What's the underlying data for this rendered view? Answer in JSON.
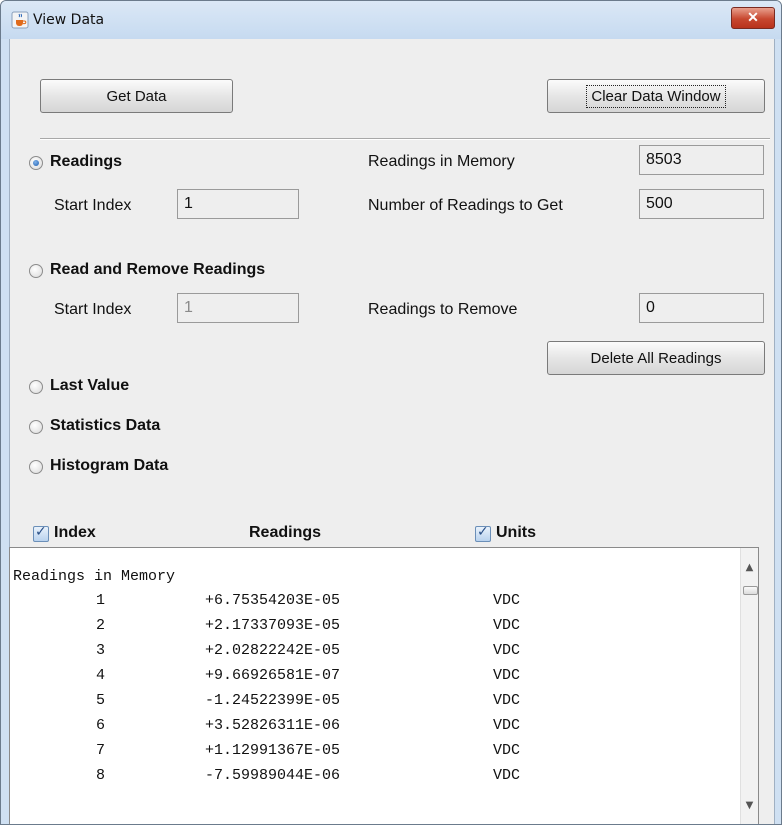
{
  "window": {
    "title": "View Data",
    "close_label": "✕",
    "icon": "java-cup-icon"
  },
  "toolbar": {
    "get_data_label": "Get Data",
    "clear_label": "Clear Data Window"
  },
  "readings": {
    "label": "Readings",
    "selected": true,
    "start_index_label": "Start Index",
    "start_index_value": "1",
    "in_memory_label": "Readings in Memory",
    "in_memory_value": "8503",
    "count_label": "Number of Readings to Get",
    "count_value": "500"
  },
  "read_remove": {
    "label": "Read and Remove Readings",
    "start_index_label": "Start Index",
    "start_index_value": "1",
    "remove_label": "Readings to Remove",
    "remove_value": "0",
    "delete_all_label": "Delete All Readings"
  },
  "options": {
    "last_value": "Last Value",
    "statistics": "Statistics Data",
    "histogram": "Histogram Data"
  },
  "columns": {
    "index": "Index",
    "readings": "Readings",
    "units": "Units",
    "index_checked": true,
    "units_checked": true
  },
  "output": {
    "title": "Readings in Memory",
    "rows": [
      {
        "index": "1",
        "value": "+6.75354203E-05",
        "unit": "VDC"
      },
      {
        "index": "2",
        "value": "+2.17337093E-05",
        "unit": "VDC"
      },
      {
        "index": "3",
        "value": "+2.02822242E-05",
        "unit": "VDC"
      },
      {
        "index": "4",
        "value": "+9.66926581E-07",
        "unit": "VDC"
      },
      {
        "index": "5",
        "value": "-1.24522399E-05",
        "unit": "VDC"
      },
      {
        "index": "6",
        "value": "+3.52826311E-06",
        "unit": "VDC"
      },
      {
        "index": "7",
        "value": "+1.12991367E-05",
        "unit": "VDC"
      },
      {
        "index": "8",
        "value": "-7.59989044E-06",
        "unit": "VDC"
      }
    ]
  },
  "colors": {
    "window_frame": "#cfe0f2",
    "panel": "#eeeeee",
    "radio_selected": "#1f5fb0",
    "close_button": "#c7472f"
  }
}
